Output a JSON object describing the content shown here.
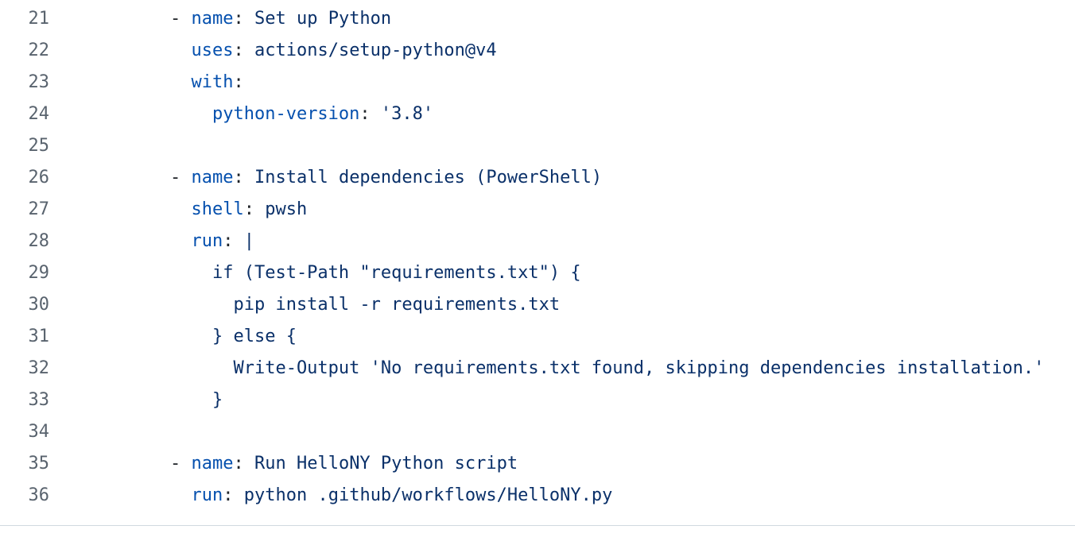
{
  "colors": {
    "line_number": "#59636e",
    "key": "#0550ae",
    "value": "#0a3069",
    "text": "#1f2328",
    "border": "#d1d9e0"
  },
  "lines": [
    {
      "number": "21",
      "segments": [
        {
          "type": "punct",
          "text": "- "
        },
        {
          "type": "key",
          "text": "name"
        },
        {
          "type": "punct",
          "text": ": "
        },
        {
          "type": "value",
          "text": "Set up Python"
        }
      ]
    },
    {
      "number": "22",
      "segments": [
        {
          "type": "plain",
          "text": "  "
        },
        {
          "type": "key",
          "text": "uses"
        },
        {
          "type": "punct",
          "text": ": "
        },
        {
          "type": "value",
          "text": "actions/setup-python@v4"
        }
      ]
    },
    {
      "number": "23",
      "segments": [
        {
          "type": "plain",
          "text": "  "
        },
        {
          "type": "key",
          "text": "with"
        },
        {
          "type": "punct",
          "text": ":"
        }
      ]
    },
    {
      "number": "24",
      "segments": [
        {
          "type": "plain",
          "text": "    "
        },
        {
          "type": "key",
          "text": "python-version"
        },
        {
          "type": "punct",
          "text": ": "
        },
        {
          "type": "value",
          "text": "'3.8'"
        }
      ]
    },
    {
      "number": "25",
      "segments": []
    },
    {
      "number": "26",
      "segments": [
        {
          "type": "punct",
          "text": "- "
        },
        {
          "type": "key",
          "text": "name"
        },
        {
          "type": "punct",
          "text": ": "
        },
        {
          "type": "value",
          "text": "Install dependencies (PowerShell)"
        }
      ]
    },
    {
      "number": "27",
      "segments": [
        {
          "type": "plain",
          "text": "  "
        },
        {
          "type": "key",
          "text": "shell"
        },
        {
          "type": "punct",
          "text": ": "
        },
        {
          "type": "value",
          "text": "pwsh"
        }
      ]
    },
    {
      "number": "28",
      "segments": [
        {
          "type": "plain",
          "text": "  "
        },
        {
          "type": "key",
          "text": "run"
        },
        {
          "type": "punct",
          "text": ": "
        },
        {
          "type": "value",
          "text": "|"
        }
      ]
    },
    {
      "number": "29",
      "segments": [
        {
          "type": "value",
          "text": "    if (Test-Path \"requirements.txt\") {"
        }
      ]
    },
    {
      "number": "30",
      "segments": [
        {
          "type": "value",
          "text": "      pip install -r requirements.txt"
        }
      ]
    },
    {
      "number": "31",
      "segments": [
        {
          "type": "value",
          "text": "    } else {"
        }
      ]
    },
    {
      "number": "32",
      "segments": [
        {
          "type": "value",
          "text": "      Write-Output 'No requirements.txt found, skipping dependencies installation.'"
        }
      ]
    },
    {
      "number": "33",
      "segments": [
        {
          "type": "value",
          "text": "    }"
        }
      ]
    },
    {
      "number": "34",
      "segments": []
    },
    {
      "number": "35",
      "segments": [
        {
          "type": "punct",
          "text": "- "
        },
        {
          "type": "key",
          "text": "name"
        },
        {
          "type": "punct",
          "text": ": "
        },
        {
          "type": "value",
          "text": "Run HelloNY Python script"
        }
      ]
    },
    {
      "number": "36",
      "segments": [
        {
          "type": "plain",
          "text": "  "
        },
        {
          "type": "key",
          "text": "run"
        },
        {
          "type": "punct",
          "text": ": "
        },
        {
          "type": "value",
          "text": "python .github/workflows/HelloNY.py"
        }
      ]
    }
  ]
}
